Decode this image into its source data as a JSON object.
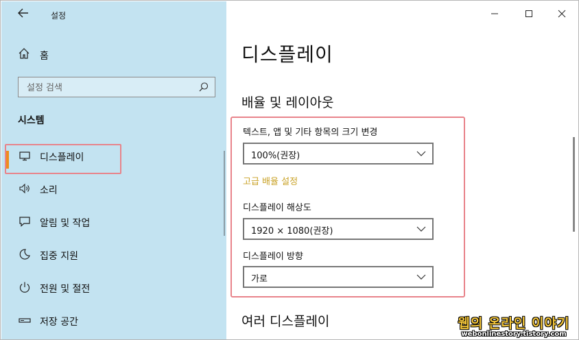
{
  "app": {
    "title": "설정"
  },
  "sidebar": {
    "home_label": "홈",
    "search_placeholder": "설정 검색",
    "section": "시스템",
    "items": [
      {
        "label": "디스플레이",
        "icon": "monitor-icon",
        "active": true
      },
      {
        "label": "소리",
        "icon": "speaker-icon"
      },
      {
        "label": "알림 및 작업",
        "icon": "notification-icon"
      },
      {
        "label": "집중 지원",
        "icon": "moon-icon"
      },
      {
        "label": "전원 및 절전",
        "icon": "power-icon"
      },
      {
        "label": "저장 공간",
        "icon": "storage-icon"
      }
    ]
  },
  "window": {
    "minimize": "—",
    "maximize": "☐",
    "close": "✕"
  },
  "main": {
    "title": "디스플레이",
    "section_scale": "배율 및 레이아웃",
    "scale_label": "텍스트, 앱 및 기타 항목의 크기 변경",
    "scale_value": "100%(권장)",
    "advanced_link": "고급 배율 설정",
    "resolution_label": "디스플레이 해상도",
    "resolution_value": "1920 × 1080(권장)",
    "orientation_label": "디스플레이 방향",
    "orientation_value": "가로",
    "section_multi": "여러 디스플레이"
  },
  "watermark": {
    "title": "웹의 온라인 이야기",
    "url": "webonlinestory.tistory.com"
  },
  "colors": {
    "sidebar_bg": "#c3e3f1",
    "accent": "#ef8c1b",
    "highlight": "#e8838a",
    "link": "#c9a227"
  }
}
